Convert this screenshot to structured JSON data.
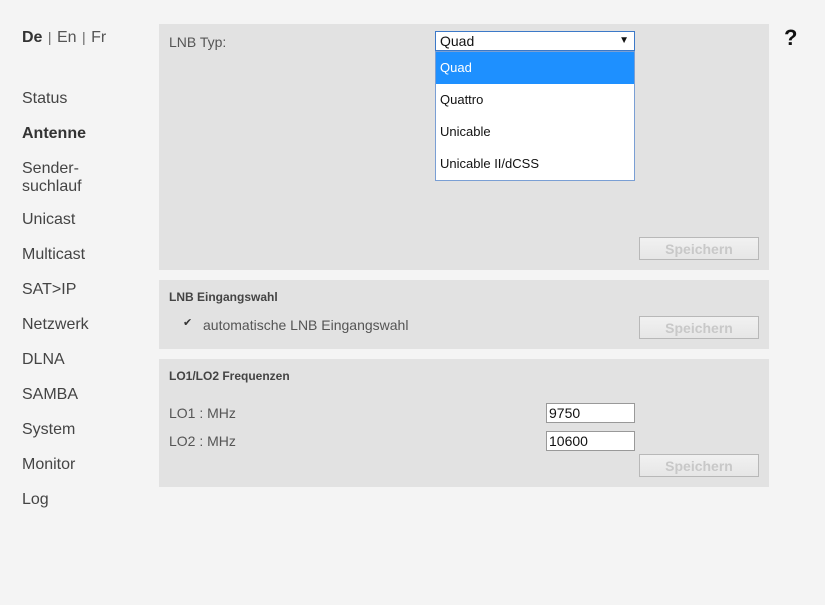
{
  "languages": {
    "de": "De",
    "en": "En",
    "fr": "Fr",
    "separator": "|"
  },
  "help": "?",
  "nav": [
    "Status",
    "Antenne",
    "Sender-",
    "suchlauf",
    "Unicast",
    "Multicast",
    "SAT>IP",
    "Netzwerk",
    "DLNA",
    "SAMBA",
    "System",
    "Monitor",
    "Log"
  ],
  "lnb_type": {
    "label": "LNB Typ:",
    "selected": "Quad",
    "options": [
      "Quad",
      "Quattro",
      "Unicable",
      "Unicable II/dCSS"
    ],
    "save": "Speichern"
  },
  "lnb_input": {
    "title": "LNB Eingangswahl",
    "checkbox_label": "automatische LNB Eingangswahl",
    "checked": true,
    "save": "Speichern"
  },
  "lo_freq": {
    "title": "LO1/LO2 Frequenzen",
    "lo1_label": "LO1 : MHz",
    "lo1_value": "9750",
    "lo2_label": "LO2 : MHz",
    "lo2_value": "10600",
    "save": "Speichern"
  },
  "colors": {
    "background": "#f4f4f4",
    "panel": "#e2e2e2",
    "selected_option": "#1e90ff"
  }
}
